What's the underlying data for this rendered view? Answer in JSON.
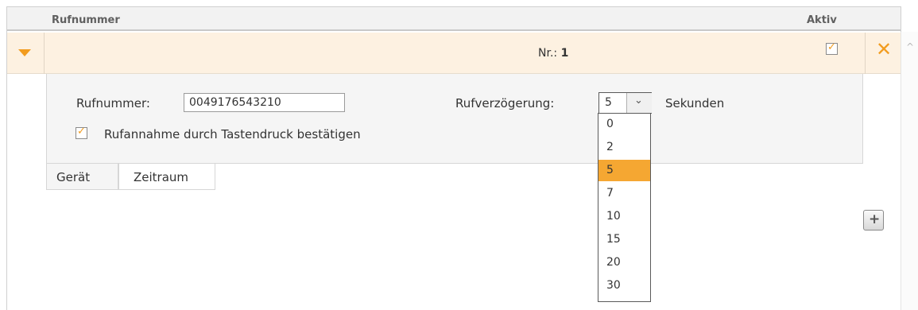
{
  "header": {
    "col_rufnummer": "Rufnummer",
    "col_aktiv": "Aktiv"
  },
  "entry": {
    "nr_prefix": "Nr.:",
    "nr_value": "1",
    "aktiv_checked": true
  },
  "detail": {
    "rufnummer_label": "Rufnummer:",
    "rufnummer_value": "0049176543210",
    "rufverzoegerung_label": "Rufverzögerung:",
    "rufverzoegerung_selected": "5",
    "sekunden_label": "Sekunden",
    "confirm_label": "Rufannahme durch Tastendruck bestätigen",
    "confirm_checked": true
  },
  "tabs": [
    {
      "label": "Gerät",
      "active": true
    },
    {
      "label": "Zeitraum",
      "active": false
    }
  ],
  "dropdown": {
    "options": [
      "0",
      "2",
      "5",
      "7",
      "10",
      "15",
      "20",
      "30"
    ],
    "selected": "5"
  },
  "icons": {
    "toggle": "caret-down-icon",
    "delete": "close-icon",
    "add": "plus-icon",
    "scroll": "chevron-up-icon"
  },
  "colors": {
    "accent": "#f29c1f",
    "row_highlight": "#fdf1e1",
    "selected_option": "#f5a732"
  }
}
